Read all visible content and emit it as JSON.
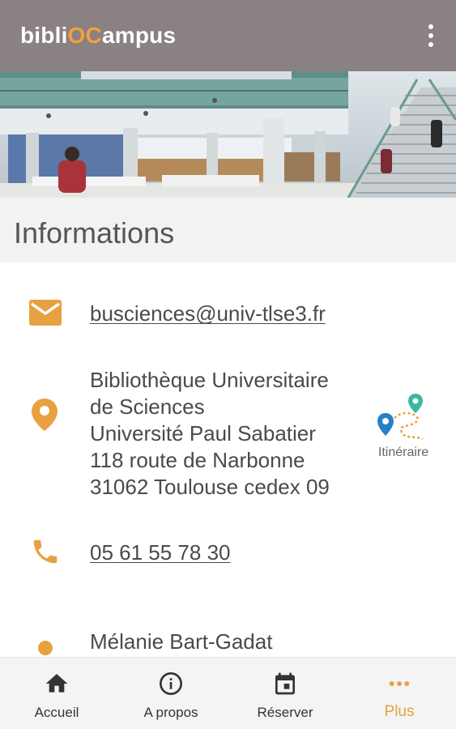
{
  "app": {
    "title_prefix": "bibli",
    "title_accent": "OC",
    "title_suffix": "ampus"
  },
  "section": {
    "title": "Informations"
  },
  "contact": {
    "email": "busciences@univ-tlse3.fr",
    "address_lines": [
      "Bibliothèque Universitaire",
      "de Sciences",
      "Université Paul Sabatier",
      "118 route de Narbonne",
      "31062 Toulouse cedex 09"
    ],
    "route_label": "Itinéraire",
    "phone": "05 61 55 78 30",
    "person": "Mélanie Bart-Gadat"
  },
  "nav": {
    "items": [
      {
        "label": "Accueil",
        "icon": "home-icon"
      },
      {
        "label": "A propos",
        "icon": "info-icon"
      },
      {
        "label": "Réserver",
        "icon": "calendar-icon"
      },
      {
        "label": "Plus",
        "icon": "more-horiz-icon"
      }
    ],
    "active": "Plus"
  },
  "colors": {
    "appbar": "#8a8183",
    "accent": "#f3a03c",
    "icon": "#e8a140",
    "section_bg": "#f2f2f2"
  }
}
